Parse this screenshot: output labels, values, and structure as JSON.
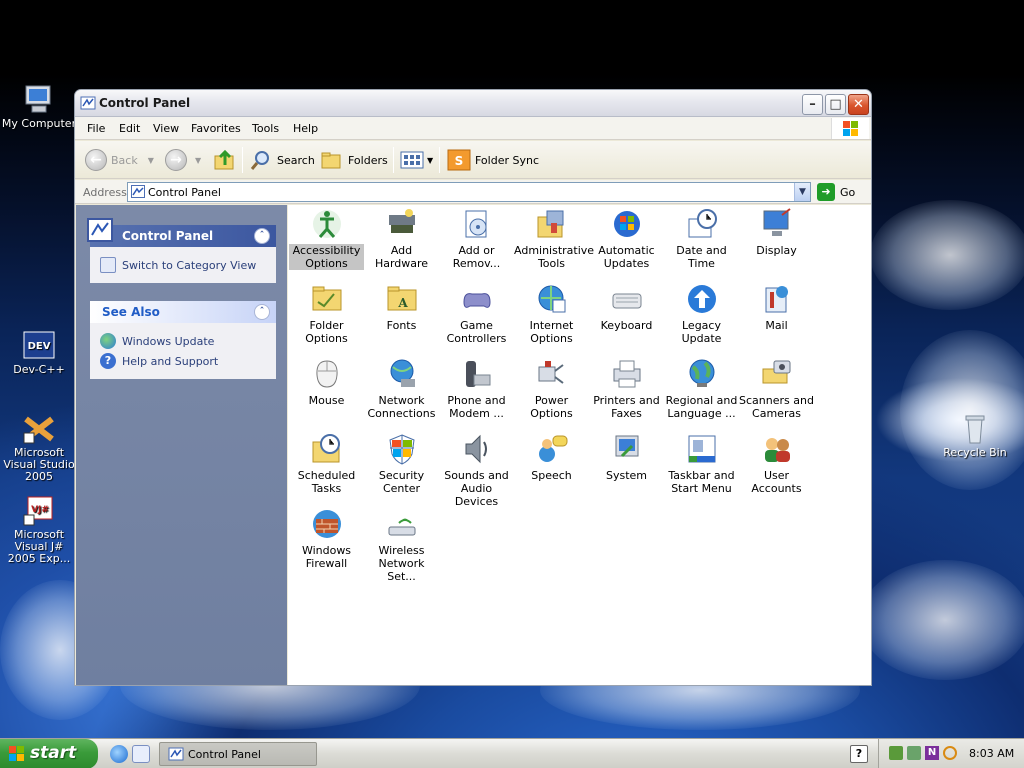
{
  "desktop": {
    "icons": [
      {
        "label": "My Computer"
      },
      {
        "label": "Dev-C++"
      },
      {
        "label": "Microsoft Visual Studio 2005"
      },
      {
        "label": "Microsoft Visual J# 2005 Exp..."
      },
      {
        "label": "Recycle Bin"
      }
    ]
  },
  "window": {
    "title": "Control Panel",
    "menu": [
      "File",
      "Edit",
      "View",
      "Favorites",
      "Tools",
      "Help"
    ],
    "toolbar": {
      "back_label": "Back",
      "search_label": "Search",
      "folders_label": "Folders",
      "foldersync_label": "Folder Sync"
    },
    "address": {
      "label": "Address",
      "value": "Control Panel",
      "go_label": "Go"
    },
    "taskpane": {
      "control_panel": {
        "title": "Control Panel",
        "links": [
          "Switch to Category View"
        ]
      },
      "see_also": {
        "title": "See Also",
        "links": [
          "Windows Update",
          "Help and Support"
        ]
      }
    },
    "items": [
      {
        "label": "Accessibility Options",
        "icon": "accessibility-icon",
        "selected": true
      },
      {
        "label": "Add Hardware",
        "icon": "add-hardware-icon"
      },
      {
        "label": "Add or Remov...",
        "icon": "add-remove-icon"
      },
      {
        "label": "Administrative Tools",
        "icon": "admin-tools-icon"
      },
      {
        "label": "Automatic Updates",
        "icon": "automatic-updates-icon"
      },
      {
        "label": "Date and Time",
        "icon": "date-time-icon"
      },
      {
        "label": "Display",
        "icon": "display-icon"
      },
      {
        "label": "Folder Options",
        "icon": "folder-options-icon"
      },
      {
        "label": "Fonts",
        "icon": "fonts-icon"
      },
      {
        "label": "Game Controllers",
        "icon": "game-controllers-icon"
      },
      {
        "label": "Internet Options",
        "icon": "internet-options-icon"
      },
      {
        "label": "Keyboard",
        "icon": "keyboard-icon"
      },
      {
        "label": "Legacy Update",
        "icon": "legacy-update-icon"
      },
      {
        "label": "Mail",
        "icon": "mail-icon"
      },
      {
        "label": "Mouse",
        "icon": "mouse-icon"
      },
      {
        "label": "Network Connections",
        "icon": "network-icon"
      },
      {
        "label": "Phone and Modem ...",
        "icon": "phone-modem-icon"
      },
      {
        "label": "Power Options",
        "icon": "power-icon"
      },
      {
        "label": "Printers and Faxes",
        "icon": "printer-icon"
      },
      {
        "label": "Regional and Language ...",
        "icon": "regional-icon"
      },
      {
        "label": "Scanners and Cameras",
        "icon": "scanner-icon"
      },
      {
        "label": "Scheduled Tasks",
        "icon": "scheduled-tasks-icon"
      },
      {
        "label": "Security Center",
        "icon": "security-center-icon"
      },
      {
        "label": "Sounds and Audio Devices",
        "icon": "sounds-icon"
      },
      {
        "label": "Speech",
        "icon": "speech-icon"
      },
      {
        "label": "System",
        "icon": "system-icon"
      },
      {
        "label": "Taskbar and Start Menu",
        "icon": "taskbar-icon"
      },
      {
        "label": "User Accounts",
        "icon": "user-accounts-icon"
      },
      {
        "label": "Windows Firewall",
        "icon": "firewall-icon"
      },
      {
        "label": "Wireless Network Set...",
        "icon": "wireless-icon"
      }
    ]
  },
  "taskbar": {
    "start_label": "start",
    "task_label": "Control Panel",
    "clock": "8:03 AM"
  }
}
